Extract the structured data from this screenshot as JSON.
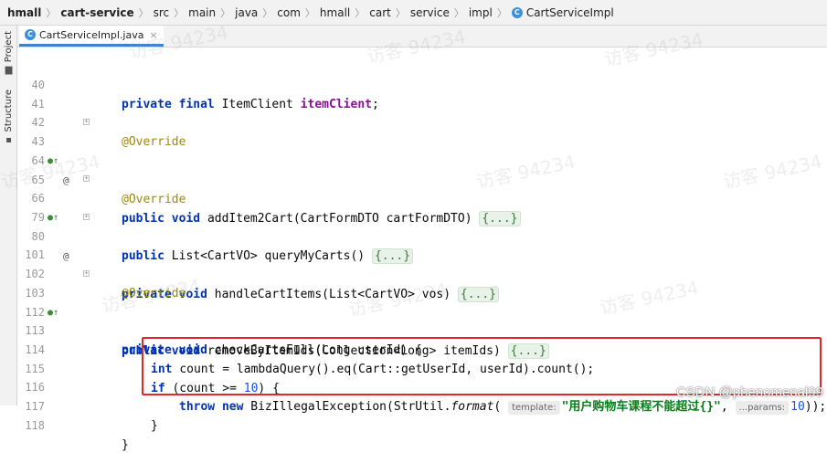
{
  "breadcrumb": {
    "items": [
      "hmall",
      "cart-service",
      "src",
      "main",
      "java",
      "com",
      "hmall",
      "cart",
      "service",
      "impl"
    ],
    "class_name": "CartServiceImpl",
    "class_icon_letter": "C"
  },
  "tool_strip": {
    "project_label": "Project",
    "structure_label": "Structure"
  },
  "tab": {
    "label": "CartServiceImpl.java",
    "icon_letter": "C",
    "close": "×"
  },
  "editor": {
    "line_numbers": [
      "40",
      "41",
      "42",
      "43",
      "64",
      "65",
      "66",
      "79",
      "80",
      "101",
      "102",
      "103",
      "112",
      "113",
      "114",
      "115",
      "116",
      "117",
      "118"
    ],
    "lines": {
      "l40": {
        "kw1": "private",
        "kw2": "final",
        "type": "ItemClient",
        "field": "itemClient",
        "end": ";"
      },
      "l42": {
        "ann": "@Override"
      },
      "l43": {
        "kw1": "public",
        "kw2": "void",
        "rest": "addItem2Cart(CartFormDTO cartFormDTO)",
        "fold": "{...}"
      },
      "l65": {
        "ann": "@Override"
      },
      "l66": {
        "kw1": "public",
        "rest": "List<CartVO> queryMyCarts()",
        "fold": "{...}"
      },
      "l80": {
        "kw1": "private",
        "kw2": "void",
        "rest": "handleCartItems(List<CartVO> vos)",
        "fold": "{...}"
      },
      "l102": {
        "ann": "@Override"
      },
      "l103": {
        "kw1": "public",
        "kw2": "void",
        "rest": "removeByItemIds(Collection<Long> itemIds)",
        "fold": "{...}"
      },
      "l113": {
        "kw1": "private",
        "kw2": "void",
        "rest": "checkCartsFull(Long userId) {"
      },
      "l114": {
        "kw1": "int",
        "rest": "count = lambdaQuery().eq(Cart::getUserId, userId).count();"
      },
      "l115": {
        "kw1": "if",
        "rest1": "(count >= ",
        "num": "10",
        "rest2": ") {"
      },
      "l116": {
        "kw1": "throw",
        "kw2": "new",
        "rest1": "BizIllegalException(StrUtil.",
        "method": "format",
        "paren": "(",
        "hint1": "template:",
        "str": "\"用户购物车课程不能超过{}\"",
        "comma": ",",
        "hint2": "...params:",
        "num": "10",
        "end": "));"
      },
      "l117": {
        "rest": "}"
      },
      "l118": {
        "rest": "}"
      }
    }
  },
  "watermark_text": "访客 94234",
  "csdn_watermark": "CSDN @phenomenal99",
  "colors": {
    "keyword": "#0033b3",
    "annotation": "#9e880d",
    "field": "#871094",
    "number": "#1750eb",
    "string": "#067d17",
    "highlight_box": "#e02828"
  }
}
